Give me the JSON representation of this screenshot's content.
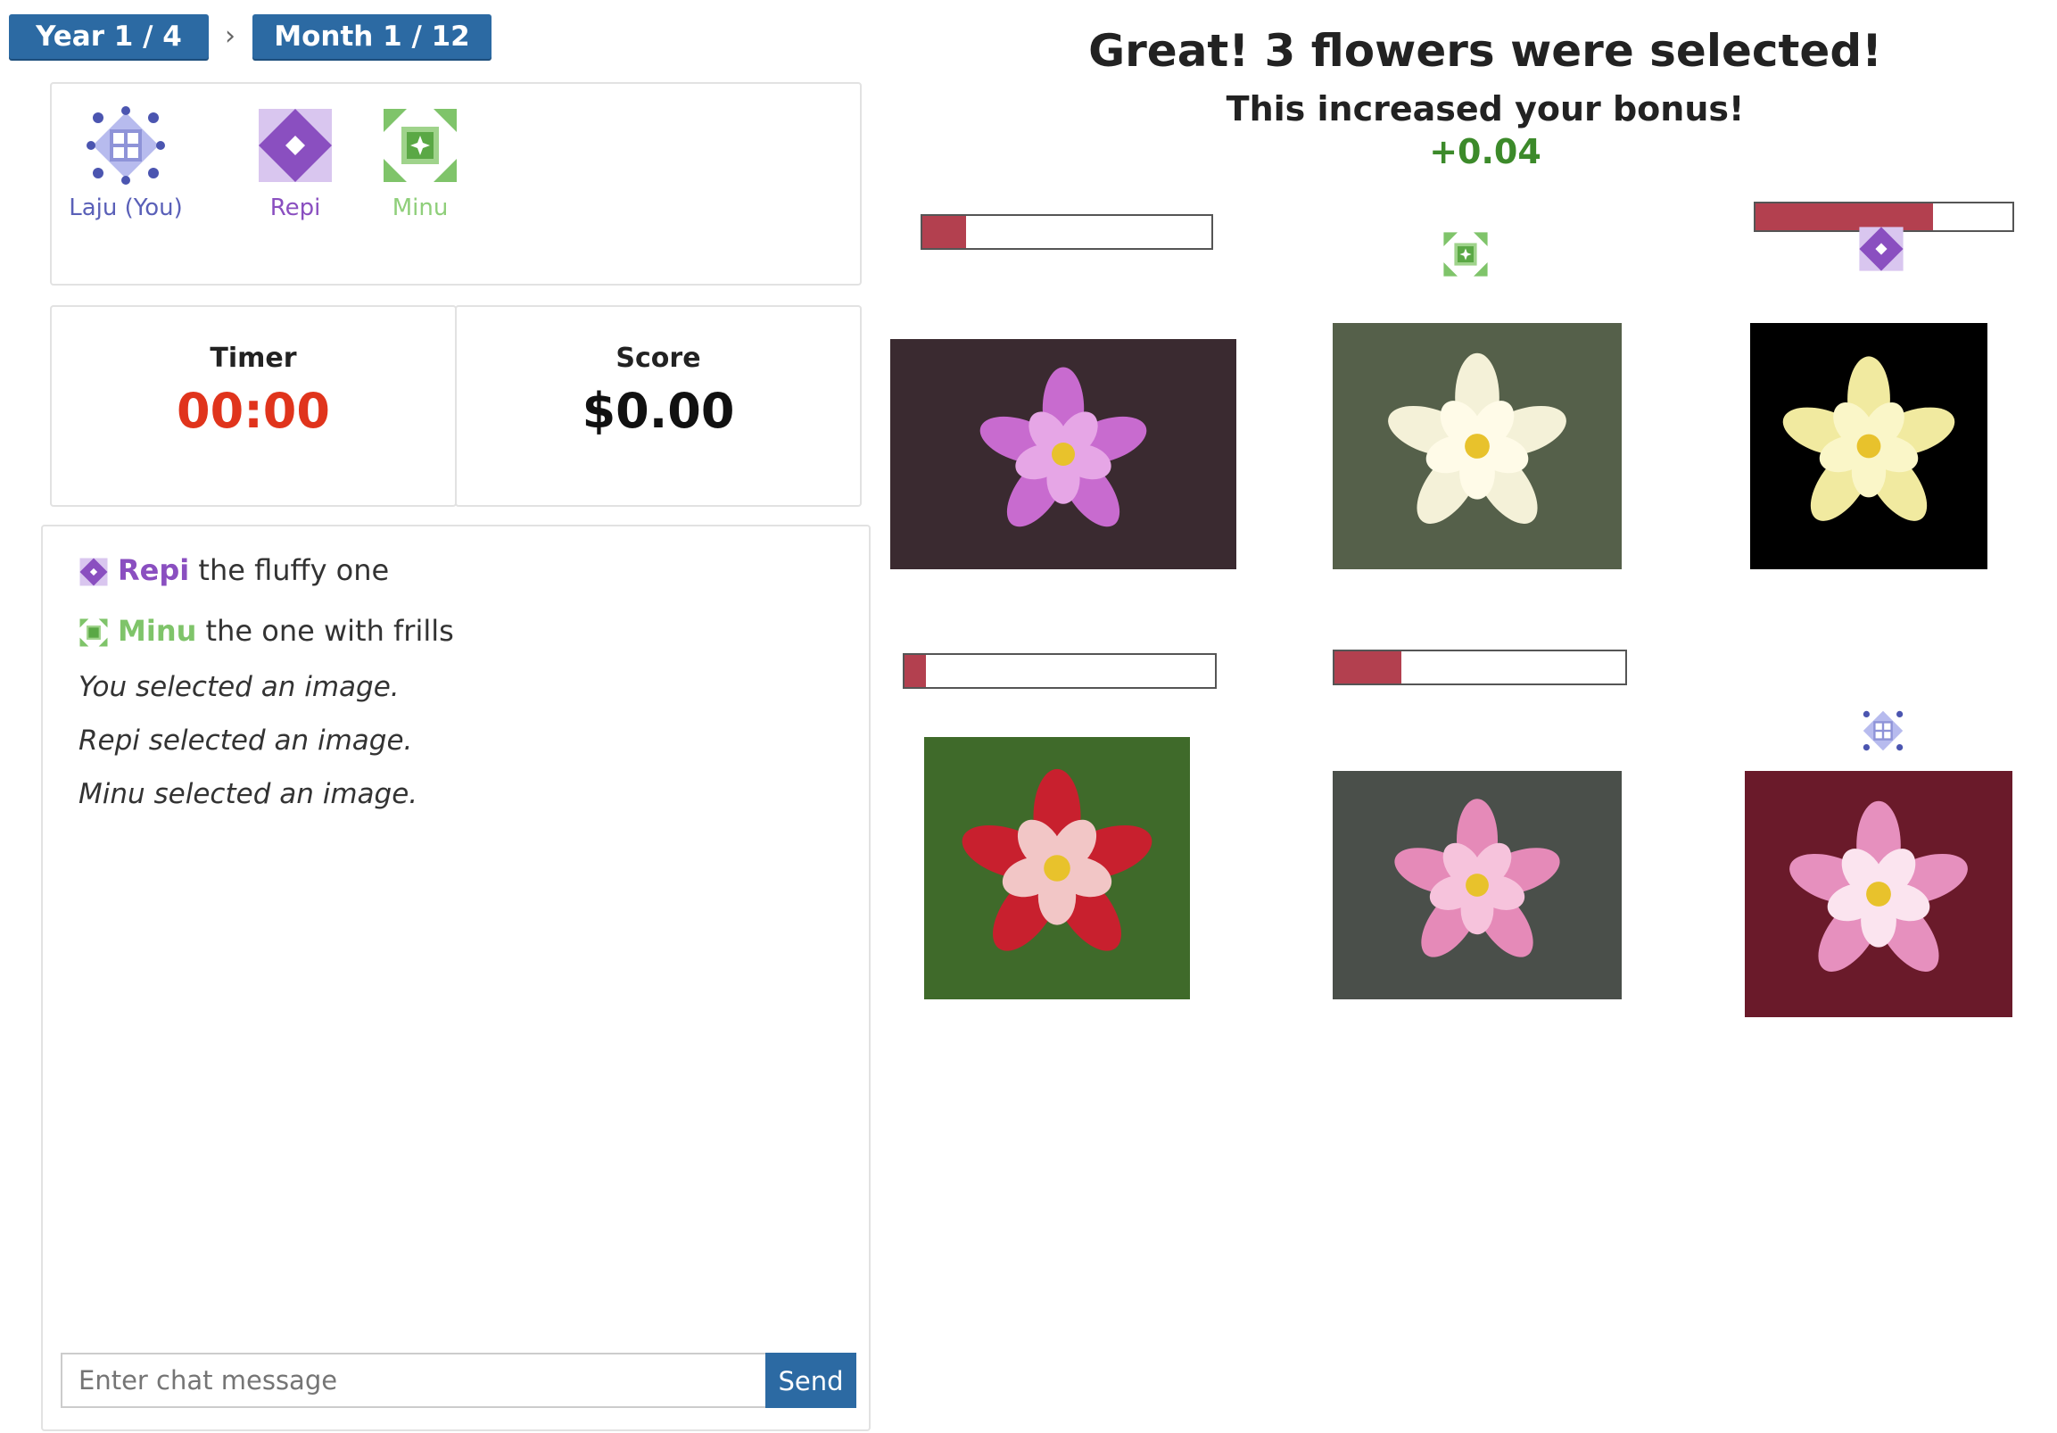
{
  "breadcrumb": {
    "year": "Year 1 / 4",
    "separator": "›",
    "month": "Month 1 / 12"
  },
  "players": [
    {
      "name": "Laju (You)",
      "color": "#6a6fc4",
      "icon": "grid-quilt-icon"
    },
    {
      "name": "Repi",
      "color": "#8a4fc0",
      "icon": "diamond-quilt-icon"
    },
    {
      "name": "Minu",
      "color": "#7fc46a",
      "icon": "star-quilt-icon"
    }
  ],
  "stats": {
    "timer_label": "Timer",
    "timer_value": "00:00",
    "timer_color": "#e0341c",
    "score_label": "Score",
    "score_value": "$0.00"
  },
  "chat": {
    "messages": [
      {
        "sender": "Repi",
        "text": "the fluffy one",
        "color": "#8a4fc0"
      },
      {
        "sender": "Minu",
        "text": "the one with frills",
        "color": "#7fc46a"
      }
    ],
    "events": [
      "You selected an image.",
      "Repi selected an image.",
      "Minu selected an image."
    ],
    "input_placeholder": "Enter chat message",
    "send_label": "Send"
  },
  "result": {
    "title": "Great! 3 flowers were selected!",
    "subtitle": "This increased your bonus!",
    "bonus": "+0.04",
    "bonus_color": "#3c8a2a"
  },
  "flowers": [
    {
      "id": 1,
      "colors": [
        "#c86bcf",
        "#e6a6e6",
        "#3a2a30"
      ],
      "bar_fraction": 0.15,
      "selected_by": null
    },
    {
      "id": 2,
      "colors": [
        "#f4f1d8",
        "#fffbe8",
        "#55604a"
      ],
      "bar_fraction": null,
      "selected_by": "Minu"
    },
    {
      "id": 3,
      "colors": [
        "#f1eaa0",
        "#faf6c8",
        "#000000"
      ],
      "bar_fraction": 0.69,
      "selected_by": "Repi"
    },
    {
      "id": 4,
      "colors": [
        "#c8202e",
        "#f2c6c6",
        "#3f6a2a"
      ],
      "bar_fraction": 0.07,
      "selected_by": null
    },
    {
      "id": 5,
      "colors": [
        "#e58ab8",
        "#f6c3dc",
        "#4a4f4a"
      ],
      "bar_fraction": 0.23,
      "selected_by": null
    },
    {
      "id": 6,
      "colors": [
        "#e690be",
        "#fbe4ef",
        "#6a1a2a"
      ],
      "bar_fraction": null,
      "selected_by": "Laju (You)"
    }
  ],
  "colors": {
    "accent": "#2c6aa3",
    "bar_fill": "#b3404f"
  }
}
